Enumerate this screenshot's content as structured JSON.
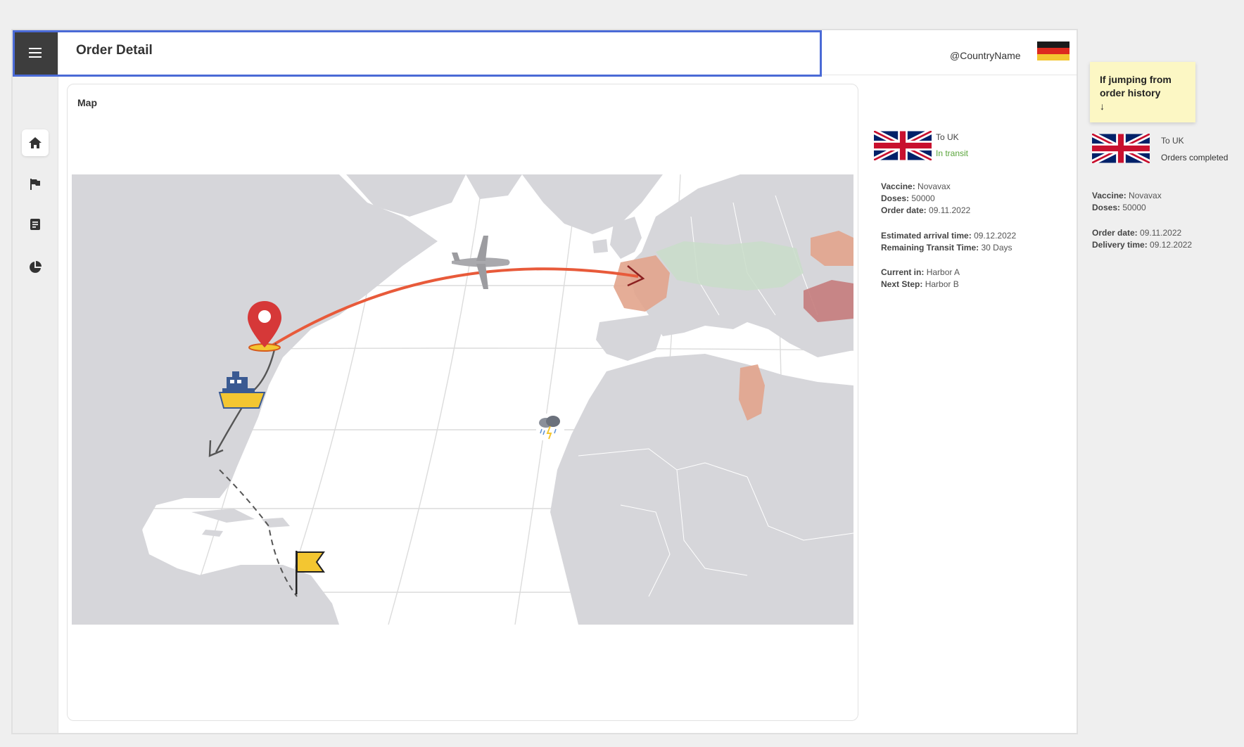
{
  "header": {
    "title": "Order Detail",
    "country_name": "@CountryName"
  },
  "sidebar": {
    "items": [
      {
        "name": "home-icon"
      },
      {
        "name": "flag-icon"
      },
      {
        "name": "document-icon"
      },
      {
        "name": "pie-chart-icon"
      }
    ]
  },
  "map": {
    "title": "Map"
  },
  "current_order": {
    "destination": "To UK",
    "status": "In transit",
    "vaccine_label": "Vaccine:",
    "vaccine": "Novavax",
    "doses_label": "Doses:",
    "doses": "50000",
    "order_date_label": "Order date:",
    "order_date": "09.11.2022",
    "eta_label": "Estimated arrival time:",
    "eta": "09.12.2022",
    "remaining_label": "Remaining Transit Time:",
    "remaining": "30 Days",
    "current_in_label": "Current in:",
    "current_in": "Harbor A",
    "next_step_label": "Next Step:",
    "next_step": "Harbor B",
    "status_color": "#5aa53b"
  },
  "note": {
    "text": "If jumping from order history",
    "arrow": "↓"
  },
  "history_order": {
    "destination": "To UK",
    "status": "Orders completed",
    "vaccine_label": "Vaccine:",
    "vaccine": "Novavax",
    "doses_label": "Doses:",
    "doses": "50000",
    "order_date_label": "Order date:",
    "order_date": "09.11.2022",
    "delivery_label": "Delivery time:",
    "delivery": "09.12.2022"
  },
  "colors": {
    "header_outline": "#4a6ad6",
    "route_air": "#e85a3a",
    "route_sea": "#555555",
    "map_land": "#d6d6da"
  }
}
